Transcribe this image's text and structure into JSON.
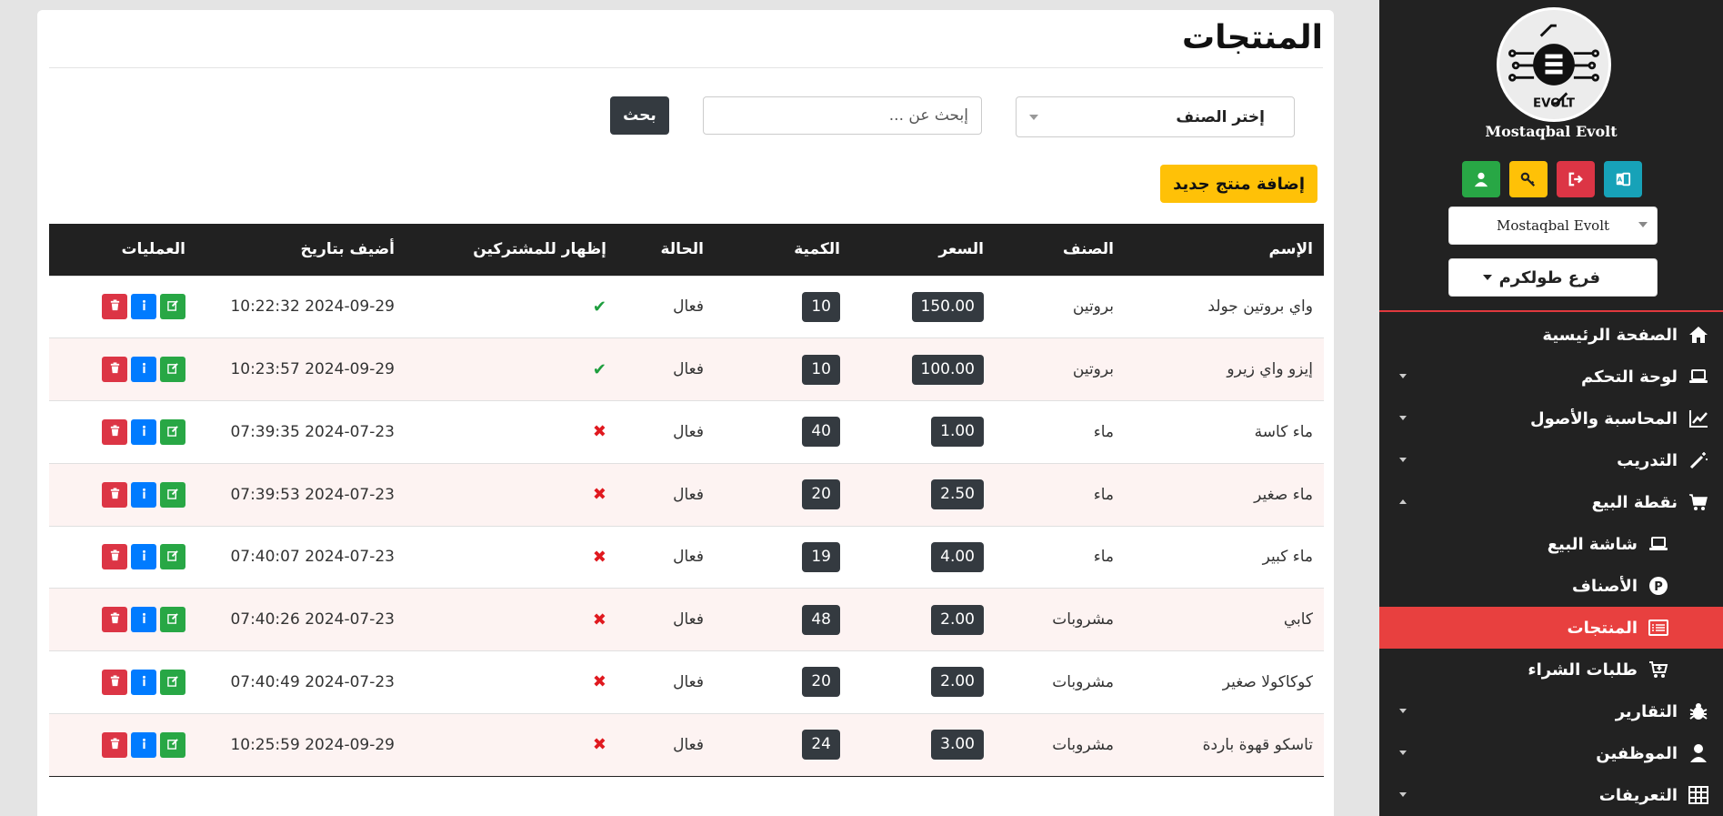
{
  "sidebar": {
    "brand_name": "Mostaqbal Evolt",
    "logo_text": "EVOLT",
    "company_select": "Mostaqbal Evolt",
    "branch_select": "فرع طولكرم",
    "quick_buttons": [
      {
        "icon": "user-icon",
        "color": "#28a745"
      },
      {
        "icon": "key-icon",
        "color": "#ffc107"
      },
      {
        "icon": "sign-out-icon",
        "color": "#dc3545"
      },
      {
        "icon": "language-icon",
        "color": "#17a2b8"
      }
    ],
    "menu": [
      {
        "label": "الصفحة الرئيسية",
        "icon": "home-icon",
        "caret": "",
        "sub": false,
        "active": false
      },
      {
        "label": "لوحة التحكم",
        "icon": "laptop-icon",
        "caret": "down",
        "sub": false,
        "active": false
      },
      {
        "label": "المحاسبة والأصول",
        "icon": "chart-line-icon",
        "caret": "down",
        "sub": false,
        "active": false
      },
      {
        "label": "التدريب",
        "icon": "magic-wand-icon",
        "caret": "down",
        "sub": false,
        "active": false
      },
      {
        "label": "نقطة البيع",
        "icon": "cart-icon",
        "caret": "up",
        "sub": false,
        "active": false
      },
      {
        "label": "شاشة البيع",
        "icon": "laptop-icon",
        "caret": "",
        "sub": true,
        "active": false
      },
      {
        "label": "الأصناف",
        "icon": "product-p-icon",
        "caret": "",
        "sub": true,
        "active": false
      },
      {
        "label": "المنتجات",
        "icon": "list-icon",
        "caret": "",
        "sub": true,
        "active": true
      },
      {
        "label": "طلبات الشراء",
        "icon": "cart-plus-icon",
        "caret": "",
        "sub": true,
        "active": false
      },
      {
        "label": "التقارير",
        "icon": "bug-icon",
        "caret": "down",
        "sub": false,
        "active": false
      },
      {
        "label": "الموظفين",
        "icon": "user-icon",
        "caret": "down",
        "sub": false,
        "active": false
      },
      {
        "label": "التعريفات",
        "icon": "table-icon",
        "caret": "down",
        "sub": false,
        "active": false
      }
    ]
  },
  "main": {
    "title": "المنتجات",
    "category_select": "إختر الصنف",
    "search_placeholder": "إبحث عن ...",
    "search_button": "بحث",
    "add_button": "إضافة منتج جديد"
  },
  "table": {
    "headers": [
      "الإسم",
      "الصنف",
      "السعر",
      "الكمية",
      "الحالة",
      "إظهار للمشتركين",
      "أضيف بتاريخ",
      "العمليات"
    ],
    "rows": [
      {
        "name": "واي بروتين جولد",
        "category": "بروتين",
        "price": "150.00",
        "qty": "10",
        "status": "فعال",
        "shown": true,
        "date": "2024-09-29 10:22:32"
      },
      {
        "name": "إيزو واي زيرو",
        "category": "بروتين",
        "price": "100.00",
        "qty": "10",
        "status": "فعال",
        "shown": true,
        "date": "2024-09-29 10:23:57"
      },
      {
        "name": "ماء كاسة",
        "category": "ماء",
        "price": "1.00",
        "qty": "40",
        "status": "فعال",
        "shown": false,
        "date": "2024-07-23 07:39:35"
      },
      {
        "name": "ماء صغير",
        "category": "ماء",
        "price": "2.50",
        "qty": "20",
        "status": "فعال",
        "shown": false,
        "date": "2024-07-23 07:39:53"
      },
      {
        "name": "ماء كبير",
        "category": "ماء",
        "price": "4.00",
        "qty": "19",
        "status": "فعال",
        "shown": false,
        "date": "2024-07-23 07:40:07"
      },
      {
        "name": "كابي",
        "category": "مشروبات",
        "price": "2.00",
        "qty": "48",
        "status": "فعال",
        "shown": false,
        "date": "2024-07-23 07:40:26"
      },
      {
        "name": "كوكاكولا صغير",
        "category": "مشروبات",
        "price": "2.00",
        "qty": "20",
        "status": "فعال",
        "shown": false,
        "date": "2024-07-23 07:40:49"
      },
      {
        "name": "تاسكو قهوة باردة",
        "category": "مشروبات",
        "price": "3.00",
        "qty": "24",
        "status": "فعال",
        "shown": false,
        "date": "2024-09-29 10:25:59"
      }
    ]
  },
  "colors": {
    "accent": "#e8403f",
    "sidebar_bg": "#222222",
    "table_header": "#212121",
    "add_button": "#ffc107"
  }
}
